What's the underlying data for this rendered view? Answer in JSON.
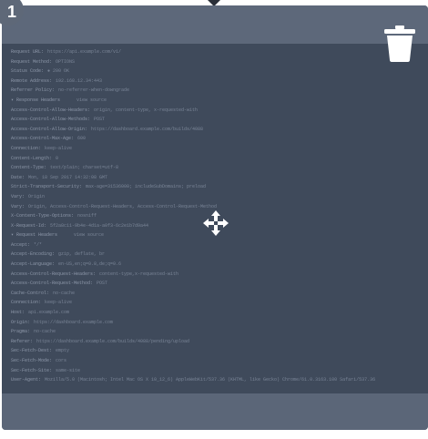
{
  "step_badge": "1",
  "icons": {
    "delete": "trash-icon",
    "move": "move-arrows-icon",
    "pointer": "caret-down-icon"
  },
  "colors": {
    "card_frame": "#5b6678",
    "card_body": "#3f4a5b",
    "badge": "#5e6878",
    "icon": "#ffffff"
  },
  "log_lines": [
    {
      "key": "Request URL:",
      "value": "https://api.example.com/v1/"
    },
    {
      "key": "Request Method:",
      "value": "OPTIONS"
    },
    {
      "key": "Status Code:",
      "value": "● 200 OK"
    },
    {
      "key": "Remote Address:",
      "value": "192.168.12.34:443"
    },
    {
      "key": "Referrer Policy:",
      "value": "no-referrer-when-downgrade"
    },
    {
      "key": "▾ Response Headers",
      "value": "view source",
      "section": true
    },
    {
      "key": "Access-Control-Allow-Headers:",
      "value": "origin, content-type, x-requested-with"
    },
    {
      "key": "Access-Control-Allow-Methods:",
      "value": "POST"
    },
    {
      "key": "Access-Control-Allow-Origin:",
      "value": "https://dashboard.example.com/builds/4088"
    },
    {
      "key": "Access-Control-Max-Age:",
      "value": "600"
    },
    {
      "key": "Connection:",
      "value": "keep-alive"
    },
    {
      "key": "Content-Length:",
      "value": "0"
    },
    {
      "key": "Content-Type:",
      "value": "text/plain; charset=utf-8"
    },
    {
      "key": "Date:",
      "value": "Mon, 18 Sep 2017 14:32:08 GMT"
    },
    {
      "key": "Strict-Transport-Security:",
      "value": "max-age=31536000; includeSubDomains; preload"
    },
    {
      "key": "Vary:",
      "value": "Origin"
    },
    {
      "key": "Vary:",
      "value": "Origin, Access-Control-Request-Headers, Access-Control-Request-Method"
    },
    {
      "key": "X-Content-Type-Options:",
      "value": "nosniff"
    },
    {
      "key": "X-Request-Id:",
      "value": "5f2a8c11-9b4e-4d1a-a0f3-6c2e1b7d9a44"
    },
    {
      "key": "▾ Request Headers",
      "value": "view source",
      "section": true
    },
    {
      "key": "Accept:",
      "value": "*/*"
    },
    {
      "key": "Accept-Encoding:",
      "value": "gzip, deflate, br"
    },
    {
      "key": "Accept-Language:",
      "value": "en-US,en;q=0.8,de;q=0.6"
    },
    {
      "key": "Access-Control-Request-Headers:",
      "value": "content-type,x-requested-with"
    },
    {
      "key": "Access-Control-Request-Method:",
      "value": "POST"
    },
    {
      "key": "Cache-Control:",
      "value": "no-cache"
    },
    {
      "key": "Connection:",
      "value": "keep-alive"
    },
    {
      "key": "Host:",
      "value": "api.example.com"
    },
    {
      "key": "Origin:",
      "value": "https://dashboard.example.com"
    },
    {
      "key": "Pragma:",
      "value": "no-cache"
    },
    {
      "key": "Referer:",
      "value": "https://dashboard.example.com/builds/4088/pending/upload"
    },
    {
      "key": "Sec-Fetch-Dest:",
      "value": "empty"
    },
    {
      "key": "Sec-Fetch-Mode:",
      "value": "cors"
    },
    {
      "key": "Sec-Fetch-Site:",
      "value": "same-site"
    },
    {
      "key": "User-Agent:",
      "value": "Mozilla/5.0 (Macintosh; Intel Mac OS X 10_12_6) AppleWebKit/537.36 (KHTML, like Gecko) Chrome/61.0.3163.100 Safari/537.36"
    }
  ]
}
